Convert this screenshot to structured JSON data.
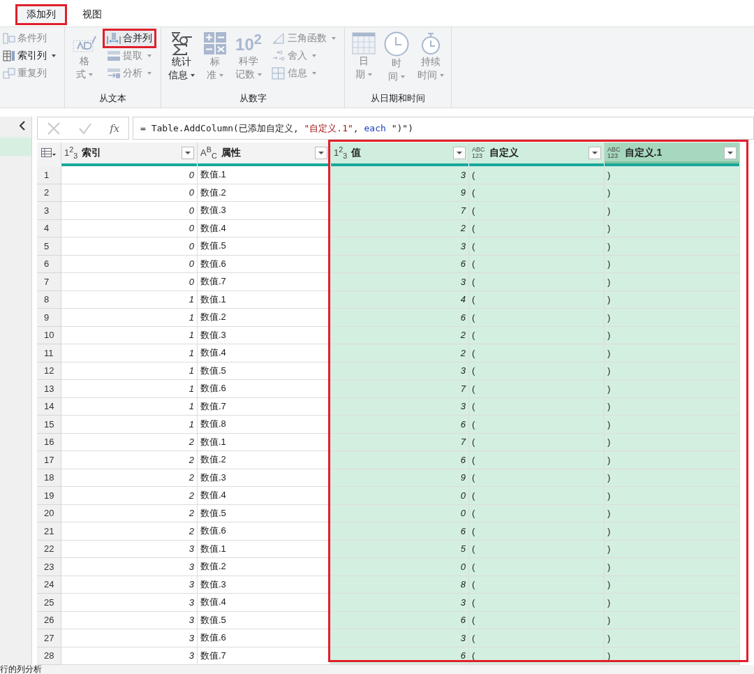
{
  "tabs": [
    {
      "label": "添加列",
      "selected": true,
      "annotated": true
    },
    {
      "label": "视图",
      "selected": false,
      "annotated": false
    }
  ],
  "ribbon": {
    "groups": [
      {
        "items": [
          {
            "kind": "small",
            "label": "条件列",
            "disabled": true,
            "dropdown": false,
            "annotated": false
          },
          {
            "kind": "small",
            "label": "索引列",
            "disabled": false,
            "dropdown": true,
            "annotated": false
          },
          {
            "kind": "small",
            "label": "重复列",
            "disabled": true,
            "dropdown": false,
            "annotated": false
          }
        ]
      },
      {
        "label": "从文本",
        "items": [
          {
            "kind": "large",
            "lines": [
              "格",
              "式"
            ],
            "disabled": true,
            "dropdown": true,
            "annotated": false
          },
          {
            "kind": "small",
            "label": "合并列",
            "disabled": false,
            "dropdown": false,
            "annotated": true
          },
          {
            "kind": "small",
            "label": "提取",
            "disabled": true,
            "dropdown": true,
            "annotated": false
          },
          {
            "kind": "small",
            "label": "分析",
            "disabled": true,
            "dropdown": true,
            "annotated": false
          }
        ]
      },
      {
        "label": "从数字",
        "items": [
          {
            "kind": "large",
            "lines": [
              "统计",
              "信息"
            ],
            "disabled": false,
            "dropdown": true,
            "annotated": false
          },
          {
            "kind": "large",
            "lines": [
              "标",
              "准"
            ],
            "disabled": true,
            "dropdown": true,
            "annotated": false
          },
          {
            "kind": "large",
            "lines": [
              "科学",
              "记数"
            ],
            "icon_text": "10$^{2}$",
            "disabled": true,
            "dropdown": true,
            "annotated": false
          },
          {
            "kind": "small",
            "label": "三角函数",
            "disabled": true,
            "dropdown": true,
            "annotated": false
          },
          {
            "kind": "small",
            "label": "舍入",
            "disabled": true,
            "dropdown": true,
            "annotated": false
          },
          {
            "kind": "small",
            "label": "信息",
            "disabled": true,
            "dropdown": true,
            "annotated": false
          }
        ]
      },
      {
        "label": "从日期和时间",
        "items": [
          {
            "kind": "large",
            "lines": [
              "日",
              "期"
            ],
            "disabled": true,
            "dropdown": true,
            "annotated": false
          },
          {
            "kind": "large",
            "lines": [
              "时",
              "间"
            ],
            "disabled": true,
            "dropdown": true,
            "annotated": false
          },
          {
            "kind": "large",
            "lines": [
              "持续",
              "时间"
            ],
            "disabled": true,
            "dropdown": true,
            "annotated": false
          }
        ]
      }
    ]
  },
  "formula_bar": {
    "fx": "fx",
    "tokens": [
      {
        "kind": "plain",
        "text": "= Table.AddColumn(已添加自定义, "
      },
      {
        "kind": "string",
        "text": "\"自定义.1\""
      },
      {
        "kind": "plain",
        "text": ", "
      },
      {
        "kind": "keyword",
        "text": "each"
      },
      {
        "kind": "plain",
        "text": " \")\")"
      }
    ]
  },
  "table": {
    "highlight_box": true,
    "columns": [
      {
        "name": "索引",
        "kind": "number",
        "type_icon": [
          "1$^{2}$$_{3}$"
        ],
        "selected": false,
        "active": false
      },
      {
        "name": "属性",
        "kind": "text",
        "type_icon": [
          "A$^{B}$$_{C}$"
        ],
        "selected": false,
        "active": false
      },
      {
        "name": "值",
        "kind": "number",
        "type_icon": [
          "1$^{2}$$_{3}$"
        ],
        "selected": true,
        "active": false
      },
      {
        "name": "自定义",
        "kind": "any",
        "type_icon": [
          "ABC",
          "123"
        ],
        "selected": true,
        "active": false
      },
      {
        "name": "自定义.1",
        "kind": "any",
        "type_icon": [
          "ABC",
          "123"
        ],
        "selected": true,
        "active": true
      }
    ],
    "rows": [
      {
        "n": "1",
        "cells": [
          "0",
          "数值.1",
          "3",
          "(",
          ")"
        ]
      },
      {
        "n": "2",
        "cells": [
          "0",
          "数值.2",
          "9",
          "(",
          ")"
        ]
      },
      {
        "n": "3",
        "cells": [
          "0",
          "数值.3",
          "7",
          "(",
          ")"
        ]
      },
      {
        "n": "4",
        "cells": [
          "0",
          "数值.4",
          "2",
          "(",
          ")"
        ]
      },
      {
        "n": "5",
        "cells": [
          "0",
          "数值.5",
          "3",
          "(",
          ")"
        ]
      },
      {
        "n": "6",
        "cells": [
          "0",
          "数值.6",
          "6",
          "(",
          ")"
        ]
      },
      {
        "n": "7",
        "cells": [
          "0",
          "数值.7",
          "3",
          "(",
          ")"
        ]
      },
      {
        "n": "8",
        "cells": [
          "1",
          "数值.1",
          "4",
          "(",
          ")"
        ]
      },
      {
        "n": "9",
        "cells": [
          "1",
          "数值.2",
          "6",
          "(",
          ")"
        ]
      },
      {
        "n": "10",
        "cells": [
          "1",
          "数值.3",
          "2",
          "(",
          ")"
        ]
      },
      {
        "n": "11",
        "cells": [
          "1",
          "数值.4",
          "2",
          "(",
          ")"
        ]
      },
      {
        "n": "12",
        "cells": [
          "1",
          "数值.5",
          "3",
          "(",
          ")"
        ]
      },
      {
        "n": "13",
        "cells": [
          "1",
          "数值.6",
          "7",
          "(",
          ")"
        ]
      },
      {
        "n": "14",
        "cells": [
          "1",
          "数值.7",
          "3",
          "(",
          ")"
        ]
      },
      {
        "n": "15",
        "cells": [
          "1",
          "数值.8",
          "6",
          "(",
          ")"
        ]
      },
      {
        "n": "16",
        "cells": [
          "2",
          "数值.1",
          "7",
          "(",
          ")"
        ]
      },
      {
        "n": "17",
        "cells": [
          "2",
          "数值.2",
          "6",
          "(",
          ")"
        ]
      },
      {
        "n": "18",
        "cells": [
          "2",
          "数值.3",
          "9",
          "(",
          ")"
        ]
      },
      {
        "n": "19",
        "cells": [
          "2",
          "数值.4",
          "0",
          "(",
          ")"
        ]
      },
      {
        "n": "20",
        "cells": [
          "2",
          "数值.5",
          "0",
          "(",
          ")"
        ]
      },
      {
        "n": "21",
        "cells": [
          "2",
          "数值.6",
          "6",
          "(",
          ")"
        ]
      },
      {
        "n": "22",
        "cells": [
          "3",
          "数值.1",
          "5",
          "(",
          ")"
        ]
      },
      {
        "n": "23",
        "cells": [
          "3",
          "数值.2",
          "0",
          "(",
          ")"
        ]
      },
      {
        "n": "24",
        "cells": [
          "3",
          "数值.3",
          "8",
          "(",
          ")"
        ]
      },
      {
        "n": "25",
        "cells": [
          "3",
          "数值.4",
          "3",
          "(",
          ")"
        ]
      },
      {
        "n": "26",
        "cells": [
          "3",
          "数值.5",
          "6",
          "(",
          ")"
        ]
      },
      {
        "n": "27",
        "cells": [
          "3",
          "数值.6",
          "3",
          "(",
          ")"
        ]
      },
      {
        "n": "28",
        "cells": [
          "3",
          "数值.7",
          "6",
          "(",
          ")"
        ]
      }
    ]
  },
  "status_bar": {
    "text": "行的列分析"
  }
}
